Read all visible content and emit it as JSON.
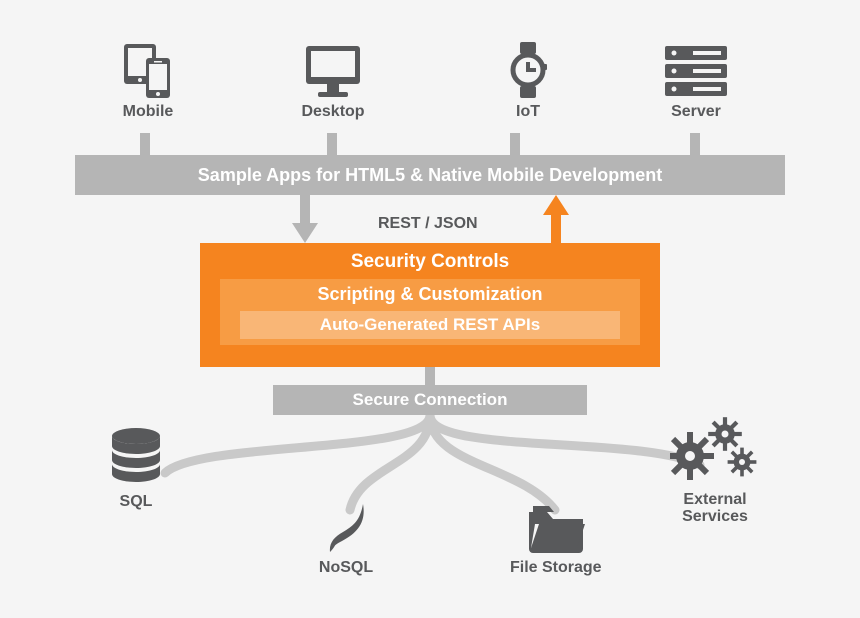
{
  "top": {
    "mobile": "Mobile",
    "desktop": "Desktop",
    "iot": "IoT",
    "server": "Server"
  },
  "bar": {
    "sample_apps": "Sample Apps for HTML5 & Native Mobile Development"
  },
  "mid": {
    "rest_json": "REST / JSON",
    "security": "Security Controls",
    "scripting": "Scripting & Customization",
    "autogen": "Auto-Generated REST APIs",
    "secure": "Secure Connection"
  },
  "bottom": {
    "sql": "SQL",
    "nosql": "NoSQL",
    "file": "File Storage",
    "ext1": "External",
    "ext2": "Services"
  }
}
